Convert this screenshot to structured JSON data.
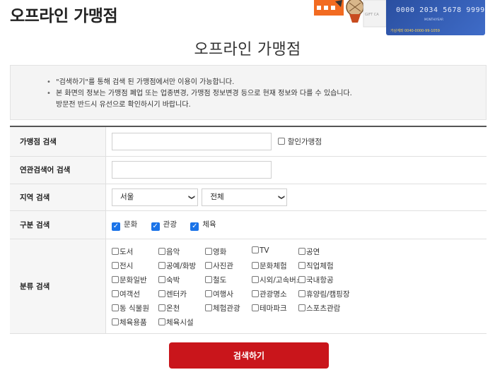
{
  "header": {
    "title": "오프라인 가맹점",
    "card_number": "0000 2034 5678 9999",
    "card_small_text": "MONTH/YEAR",
    "card_bottom_text": "가상계좌 0040-0000-99-1059",
    "gift_card_text": "GIFT CA"
  },
  "page_title": "오프라인 가맹점",
  "notice": {
    "items": [
      "\"검색하기\"를 통해 검색 된 가맹점에서만 이용이 가능합니다.",
      "본 화면의 정보는 가맹점 폐업 또는 업종변경, 가맹점 정보변경 등으로 현재 정보와 다를 수 있습니다.",
      "방문전 반드시 유선으로 확인하시기 바랍니다."
    ]
  },
  "form": {
    "store_search": {
      "label": "가맹점 검색",
      "value": "",
      "discount_label": "할인가맹점",
      "discount_checked": false
    },
    "related_search": {
      "label": "연관검색어 검색",
      "value": ""
    },
    "region_search": {
      "label": "지역 검색",
      "city": "서울",
      "district": "전체"
    },
    "type_search": {
      "label": "구분 검색",
      "options": [
        {
          "label": "문화",
          "checked": true
        },
        {
          "label": "관광",
          "checked": true
        },
        {
          "label": "체육",
          "checked": true
        }
      ]
    },
    "category_search": {
      "label": "분류 검색",
      "options": [
        "도서",
        "음악",
        "영화",
        "TV",
        "공연",
        "전시",
        "공예/화방",
        "사진관",
        "문화체험",
        "직업체험",
        "문화일반",
        "숙박",
        "철도",
        "시외/고속버스",
        "국내항공",
        "여객선",
        "렌터카",
        "여행사",
        "관광명소",
        "휴양림/캠핑장",
        "동 식물원",
        "온천",
        "체험관광",
        "테마파크",
        "스포츠관람",
        "체육용품",
        "체육시설"
      ]
    }
  },
  "search_button": "검색하기",
  "colors": {
    "accent": "#c9151b",
    "checkbox": "#1a73e8"
  }
}
